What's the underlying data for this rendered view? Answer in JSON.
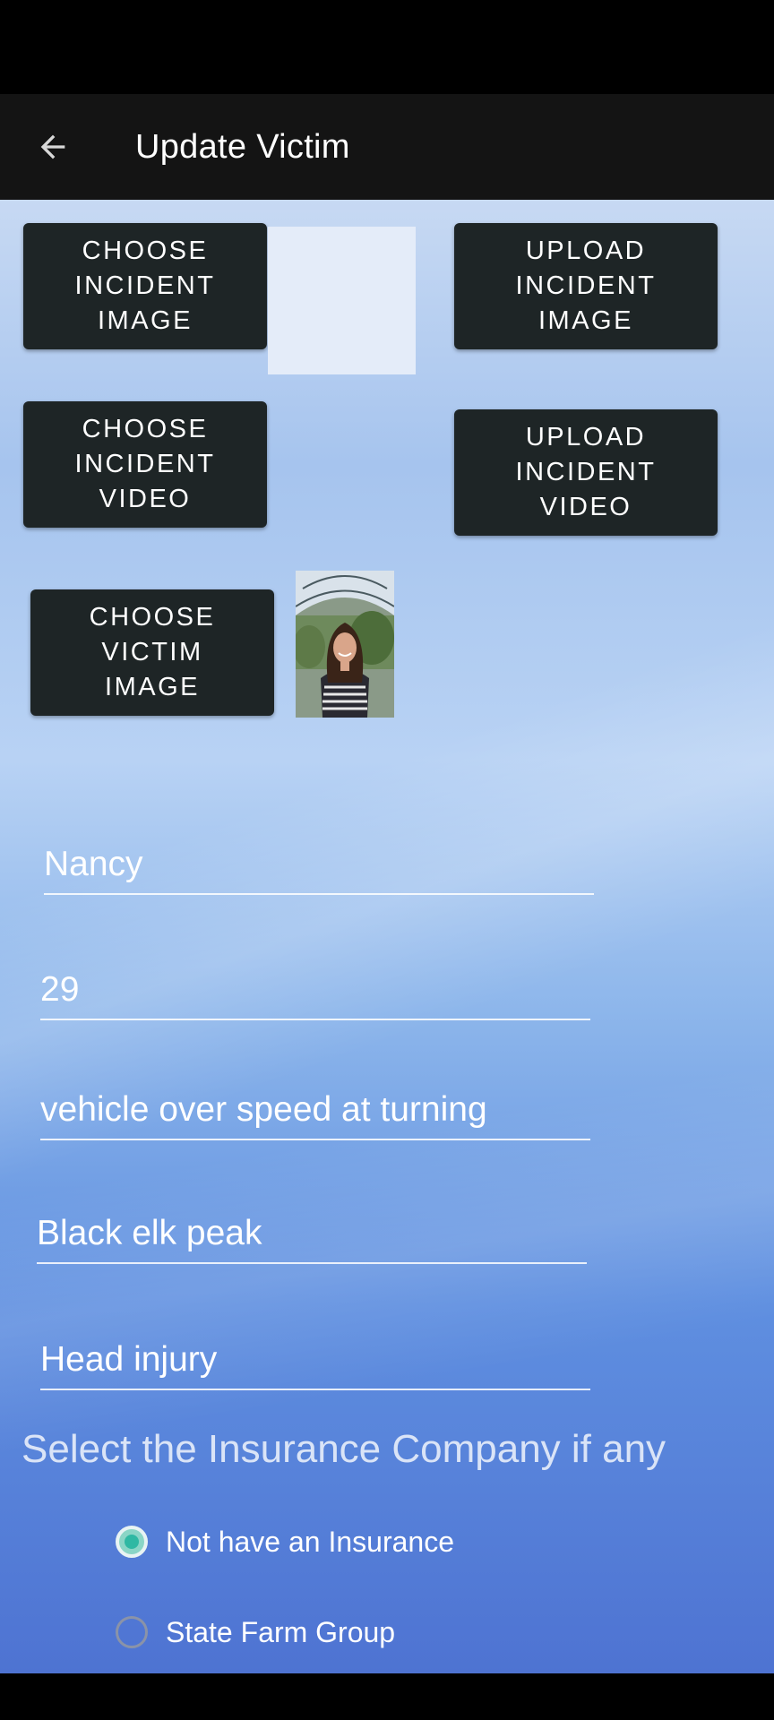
{
  "app_bar": {
    "title": "Update Victim"
  },
  "buttons": {
    "choose_incident_image": "CHOOSE\nINCIDENT\nIMAGE",
    "upload_incident_image": "UPLOAD\nINCIDENT\nIMAGE",
    "choose_incident_video": "CHOOSE\nINCIDENT\nVIDEO",
    "upload_incident_video": "UPLOAD\nINCIDENT\nVIDEO",
    "choose_victim_image": "CHOOSE\nVICTIM\nIMAGE"
  },
  "fields": {
    "name": "Nancy",
    "age": "29",
    "incident_description": "vehicle over speed at turning",
    "location": "Black elk peak",
    "injury": "Head injury"
  },
  "insurance": {
    "label": "Select the Insurance Company if any",
    "options": [
      {
        "label": "Not have an Insurance",
        "selected": true
      },
      {
        "label": "State Farm Group",
        "selected": false
      }
    ]
  },
  "colors": {
    "app_bar": "#141414",
    "button": "#1e2526",
    "radio_accent": "#2fb8a3"
  }
}
